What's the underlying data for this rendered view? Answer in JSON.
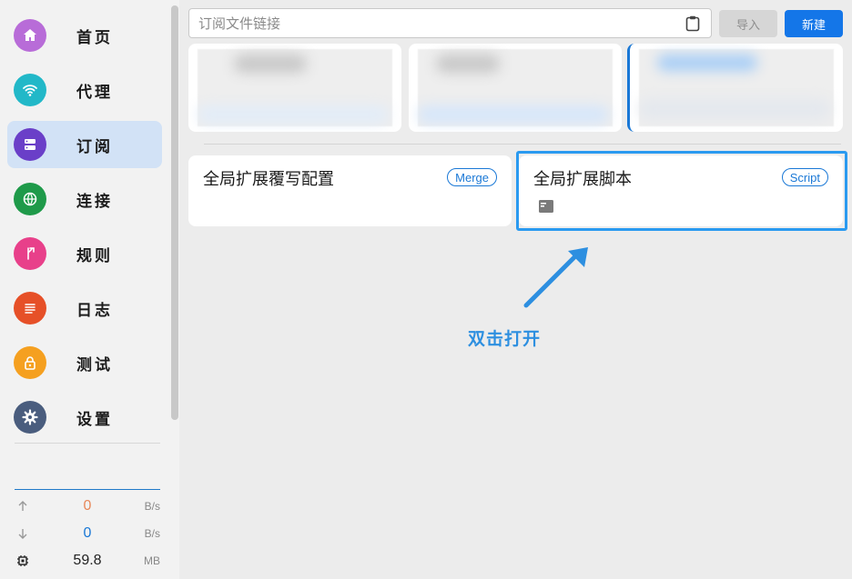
{
  "sidebar": {
    "items": [
      {
        "label": "首页",
        "icon": "home-icon",
        "color": "#b86cd8",
        "active": false
      },
      {
        "label": "代理",
        "icon": "wifi-icon",
        "color": "#22b8c8",
        "active": false
      },
      {
        "label": "订阅",
        "icon": "server-icon",
        "color": "#6a3fc8",
        "active": true
      },
      {
        "label": "连接",
        "icon": "globe-icon",
        "color": "#1f9a4a",
        "active": false
      },
      {
        "label": "规则",
        "icon": "fork-icon",
        "color": "#e8408a",
        "active": false
      },
      {
        "label": "日志",
        "icon": "list-icon",
        "color": "#e65028",
        "active": false
      },
      {
        "label": "测试",
        "icon": "lock-icon",
        "color": "#f5a020",
        "active": false
      },
      {
        "label": "设置",
        "icon": "gear-icon",
        "color": "#4a5d7e",
        "active": false
      }
    ]
  },
  "traffic": {
    "upload": {
      "value": "0",
      "unit": "B/s",
      "color": "#e8885a"
    },
    "download": {
      "value": "0",
      "unit": "B/s",
      "color": "#1a78d6"
    },
    "memory": {
      "value": "59.8",
      "unit": "MB",
      "color": "#222222"
    }
  },
  "toolbar": {
    "search_placeholder": "订阅文件链接",
    "import_label": "导入",
    "new_label": "新建"
  },
  "extensions": [
    {
      "title": "全局扩展覆写配置",
      "badge": "Merge"
    },
    {
      "title": "全局扩展脚本",
      "badge": "Script"
    }
  ],
  "annotation": {
    "hint": "双击打开",
    "color": "#2d8fe0"
  }
}
